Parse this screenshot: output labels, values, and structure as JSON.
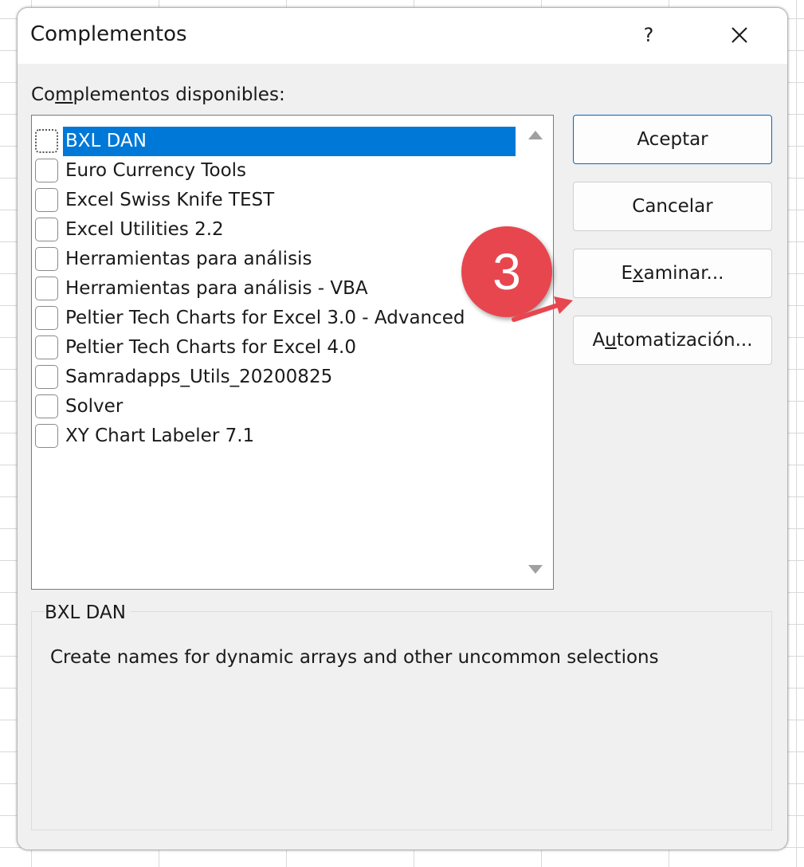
{
  "dialog": {
    "title": "Complementos",
    "help_label": "?",
    "close_icon": "close-icon"
  },
  "list": {
    "label_prefix": "Co",
    "label_underlined": "m",
    "label_suffix": "plementos disponibles:",
    "items": [
      {
        "label": "BXL DAN",
        "checked": false,
        "selected": true
      },
      {
        "label": "Euro Currency Tools",
        "checked": false,
        "selected": false
      },
      {
        "label": "Excel Swiss Knife TEST",
        "checked": false,
        "selected": false
      },
      {
        "label": "Excel Utilities 2.2",
        "checked": false,
        "selected": false
      },
      {
        "label": "Herramientas para análisis",
        "checked": false,
        "selected": false
      },
      {
        "label": "Herramientas para análisis - VBA",
        "checked": false,
        "selected": false
      },
      {
        "label": "Peltier Tech Charts for Excel 3.0 - Advanced",
        "checked": false,
        "selected": false
      },
      {
        "label": "Peltier Tech Charts for Excel 4.0",
        "checked": false,
        "selected": false
      },
      {
        "label": "Samradapps_Utils_20200825",
        "checked": false,
        "selected": false
      },
      {
        "label": "Solver",
        "checked": false,
        "selected": false
      },
      {
        "label": "XY Chart Labeler 7.1",
        "checked": false,
        "selected": false
      }
    ]
  },
  "buttons": {
    "accept": "Aceptar",
    "cancel": "Cancelar",
    "browse_prefix": "E",
    "browse_underlined": "x",
    "browse_suffix": "aminar...",
    "automation_prefix": "A",
    "automation_underlined": "u",
    "automation_suffix": "tomatización..."
  },
  "description": {
    "title": "BXL DAN",
    "text": "Create names for dynamic arrays and other uncommon selections"
  },
  "annotation": {
    "number": "3",
    "color": "#e8464f"
  },
  "colors": {
    "selection": "#0078d7",
    "dialog_bg": "#f0f0f0",
    "default_button_border": "#0067c0"
  }
}
